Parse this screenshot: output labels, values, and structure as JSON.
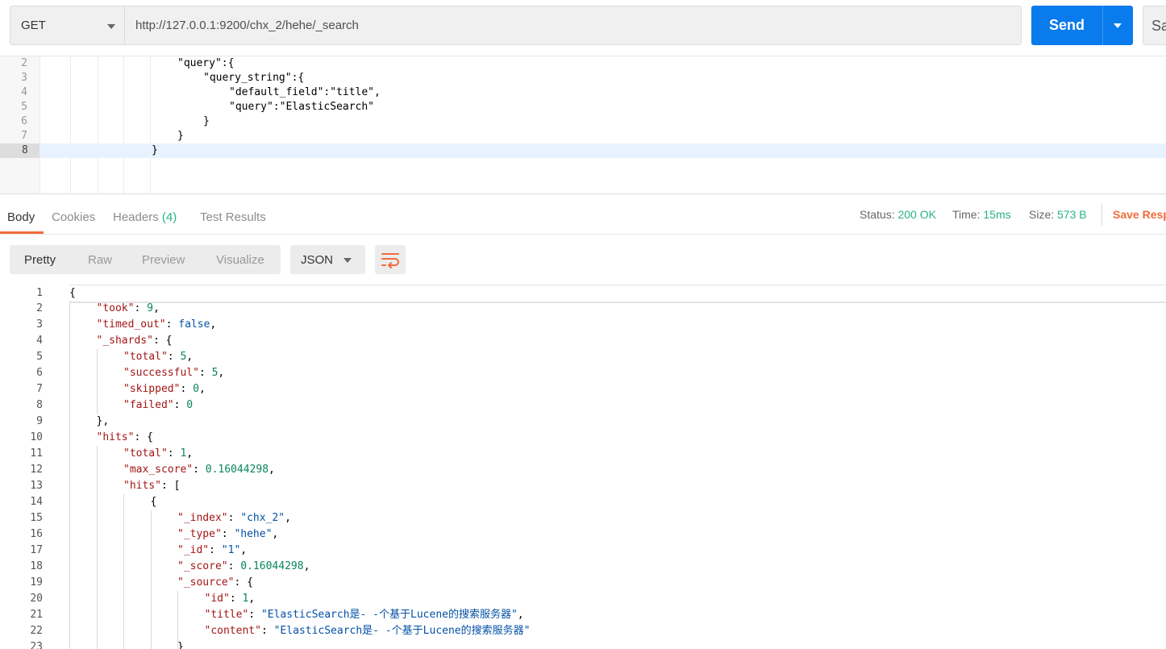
{
  "request": {
    "method": "GET",
    "url": "http://127.0.0.1:9200/chx_2/hehe/_search",
    "send_label": "Send",
    "save_label": "Sa"
  },
  "request_body": {
    "lines": [
      {
        "n": "2",
        "text": "\"query\":{",
        "indent": 172
      },
      {
        "n": "3",
        "text": "\"query_string\":{",
        "indent": 204
      },
      {
        "n": "4",
        "text": "\"default_field\":\"title\",",
        "indent": 236
      },
      {
        "n": "5",
        "text": "\"query\":\"ElasticSearch\"",
        "indent": 236
      },
      {
        "n": "6",
        "text": "}",
        "indent": 204
      },
      {
        "n": "7",
        "text": "}",
        "indent": 172
      },
      {
        "n": "8",
        "text": "}",
        "indent": 140
      }
    ]
  },
  "response_tabs": {
    "body": "Body",
    "cookies": "Cookies",
    "headers": "Headers",
    "headers_count": "(4)",
    "tests": "Test Results"
  },
  "response_meta": {
    "status_label": "Status:",
    "status_value": "200 OK",
    "time_label": "Time:",
    "time_value": "15ms",
    "size_label": "Size:",
    "size_value": "573 B",
    "save_response": "Save Resp"
  },
  "view_modes": {
    "pretty": "Pretty",
    "raw": "Raw",
    "preview": "Preview",
    "visualize": "Visualize",
    "format": "JSON"
  },
  "colors": {
    "accent": "#f26b3a",
    "send": "#097bed",
    "status_ok": "#26b47f"
  },
  "response_body": {
    "lines": [
      {
        "n": "1",
        "depth": 0,
        "parts": [
          [
            "p",
            "{"
          ]
        ]
      },
      {
        "n": "2",
        "depth": 1,
        "parts": [
          [
            "k",
            "\"took\""
          ],
          [
            "p",
            ": "
          ],
          [
            "n",
            "9"
          ],
          [
            "p",
            ","
          ]
        ]
      },
      {
        "n": "3",
        "depth": 1,
        "parts": [
          [
            "k",
            "\"timed_out\""
          ],
          [
            "p",
            ": "
          ],
          [
            "b",
            "false"
          ],
          [
            "p",
            ","
          ]
        ]
      },
      {
        "n": "4",
        "depth": 1,
        "parts": [
          [
            "k",
            "\"_shards\""
          ],
          [
            "p",
            ": {"
          ]
        ]
      },
      {
        "n": "5",
        "depth": 2,
        "parts": [
          [
            "k",
            "\"total\""
          ],
          [
            "p",
            ": "
          ],
          [
            "n",
            "5"
          ],
          [
            "p",
            ","
          ]
        ]
      },
      {
        "n": "6",
        "depth": 2,
        "parts": [
          [
            "k",
            "\"successful\""
          ],
          [
            "p",
            ": "
          ],
          [
            "n",
            "5"
          ],
          [
            "p",
            ","
          ]
        ]
      },
      {
        "n": "7",
        "depth": 2,
        "parts": [
          [
            "k",
            "\"skipped\""
          ],
          [
            "p",
            ": "
          ],
          [
            "n",
            "0"
          ],
          [
            "p",
            ","
          ]
        ]
      },
      {
        "n": "8",
        "depth": 2,
        "parts": [
          [
            "k",
            "\"failed\""
          ],
          [
            "p",
            ": "
          ],
          [
            "n",
            "0"
          ]
        ]
      },
      {
        "n": "9",
        "depth": 1,
        "parts": [
          [
            "p",
            "},"
          ]
        ]
      },
      {
        "n": "10",
        "depth": 1,
        "parts": [
          [
            "k",
            "\"hits\""
          ],
          [
            "p",
            ": {"
          ]
        ]
      },
      {
        "n": "11",
        "depth": 2,
        "parts": [
          [
            "k",
            "\"total\""
          ],
          [
            "p",
            ": "
          ],
          [
            "n",
            "1"
          ],
          [
            "p",
            ","
          ]
        ]
      },
      {
        "n": "12",
        "depth": 2,
        "parts": [
          [
            "k",
            "\"max_score\""
          ],
          [
            "p",
            ": "
          ],
          [
            "n",
            "0.16044298"
          ],
          [
            "p",
            ","
          ]
        ]
      },
      {
        "n": "13",
        "depth": 2,
        "parts": [
          [
            "k",
            "\"hits\""
          ],
          [
            "p",
            ": ["
          ]
        ]
      },
      {
        "n": "14",
        "depth": 3,
        "parts": [
          [
            "p",
            "{"
          ]
        ]
      },
      {
        "n": "15",
        "depth": 4,
        "parts": [
          [
            "k",
            "\"_index\""
          ],
          [
            "p",
            ": "
          ],
          [
            "s",
            "\"chx_2\""
          ],
          [
            "p",
            ","
          ]
        ]
      },
      {
        "n": "16",
        "depth": 4,
        "parts": [
          [
            "k",
            "\"_type\""
          ],
          [
            "p",
            ": "
          ],
          [
            "s",
            "\"hehe\""
          ],
          [
            "p",
            ","
          ]
        ]
      },
      {
        "n": "17",
        "depth": 4,
        "parts": [
          [
            "k",
            "\"_id\""
          ],
          [
            "p",
            ": "
          ],
          [
            "s",
            "\"1\""
          ],
          [
            "p",
            ","
          ]
        ]
      },
      {
        "n": "18",
        "depth": 4,
        "parts": [
          [
            "k",
            "\"_score\""
          ],
          [
            "p",
            ": "
          ],
          [
            "n",
            "0.16044298"
          ],
          [
            "p",
            ","
          ]
        ]
      },
      {
        "n": "19",
        "depth": 4,
        "parts": [
          [
            "k",
            "\"_source\""
          ],
          [
            "p",
            ": {"
          ]
        ]
      },
      {
        "n": "20",
        "depth": 5,
        "parts": [
          [
            "k",
            "\"id\""
          ],
          [
            "p",
            ": "
          ],
          [
            "n",
            "1"
          ],
          [
            "p",
            ","
          ]
        ]
      },
      {
        "n": "21",
        "depth": 5,
        "parts": [
          [
            "k",
            "\"title\""
          ],
          [
            "p",
            ": "
          ],
          [
            "s",
            "\"ElasticSearch是- -个基于Lucene的搜索服务器\""
          ],
          [
            "p",
            ","
          ]
        ]
      },
      {
        "n": "22",
        "depth": 5,
        "parts": [
          [
            "k",
            "\"content\""
          ],
          [
            "p",
            ": "
          ],
          [
            "s",
            "\"ElasticSearch是- -个基于Lucene的搜索服务器\""
          ]
        ]
      },
      {
        "n": "23",
        "depth": 4,
        "parts": [
          [
            "p",
            "}"
          ]
        ]
      }
    ]
  }
}
